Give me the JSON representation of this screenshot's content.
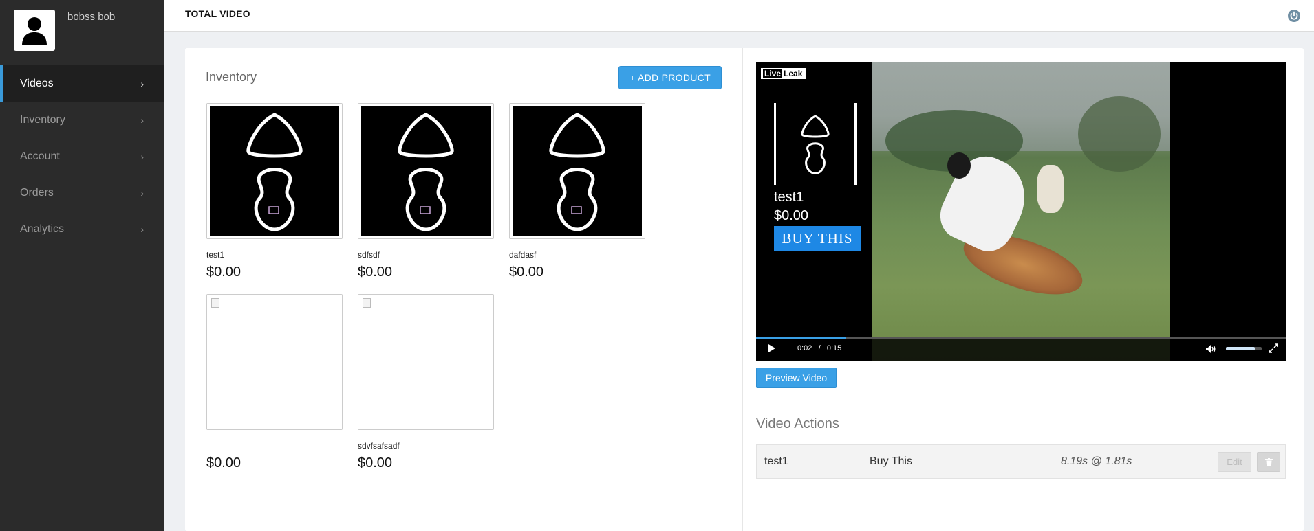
{
  "user": {
    "name": "bobss bob"
  },
  "sidebar": {
    "items": [
      {
        "label": "Videos",
        "active": true
      },
      {
        "label": "Inventory",
        "active": false
      },
      {
        "label": "Account",
        "active": false
      },
      {
        "label": "Orders",
        "active": false
      },
      {
        "label": "Analytics",
        "active": false
      }
    ],
    "chevron": "›"
  },
  "header": {
    "brand": "TOTAL VIDEO",
    "power_icon": "power-icon"
  },
  "inventory": {
    "title": "Inventory",
    "add_button": "+ ADD PRODUCT",
    "products": [
      {
        "name": "test1",
        "price": "$0.00",
        "image": "bone-scan"
      },
      {
        "name": "sdfsdf",
        "price": "$0.00",
        "image": "bone-scan"
      },
      {
        "name": "dafdasf",
        "price": "$0.00",
        "image": "bone-scan"
      },
      {
        "name": "",
        "price": "$0.00",
        "image": "broken-image"
      },
      {
        "name": "sdvfsafsadf",
        "price": "$0.00",
        "image": "broken-image"
      }
    ]
  },
  "video": {
    "watermark_a": "Live",
    "watermark_b": "Leak",
    "overlay": {
      "name": "test1",
      "price": "$0.00",
      "buy_label": "BUY THIS"
    },
    "current_time": "0:02",
    "time_separator": "/",
    "duration": "0:15",
    "progress_fraction": 0.17,
    "volume_fraction": 0.8
  },
  "preview_button": "Preview Video",
  "video_actions": {
    "title": "Video Actions",
    "rows": [
      {
        "product": "test1",
        "label": "Buy This",
        "timing": "8.19s @ 1.81s",
        "edit_label": "Edit"
      }
    ]
  },
  "colors": {
    "accent": "#3aa0e6",
    "sidebar": "#2b2b2b",
    "buy_button": "#1e88e5"
  }
}
